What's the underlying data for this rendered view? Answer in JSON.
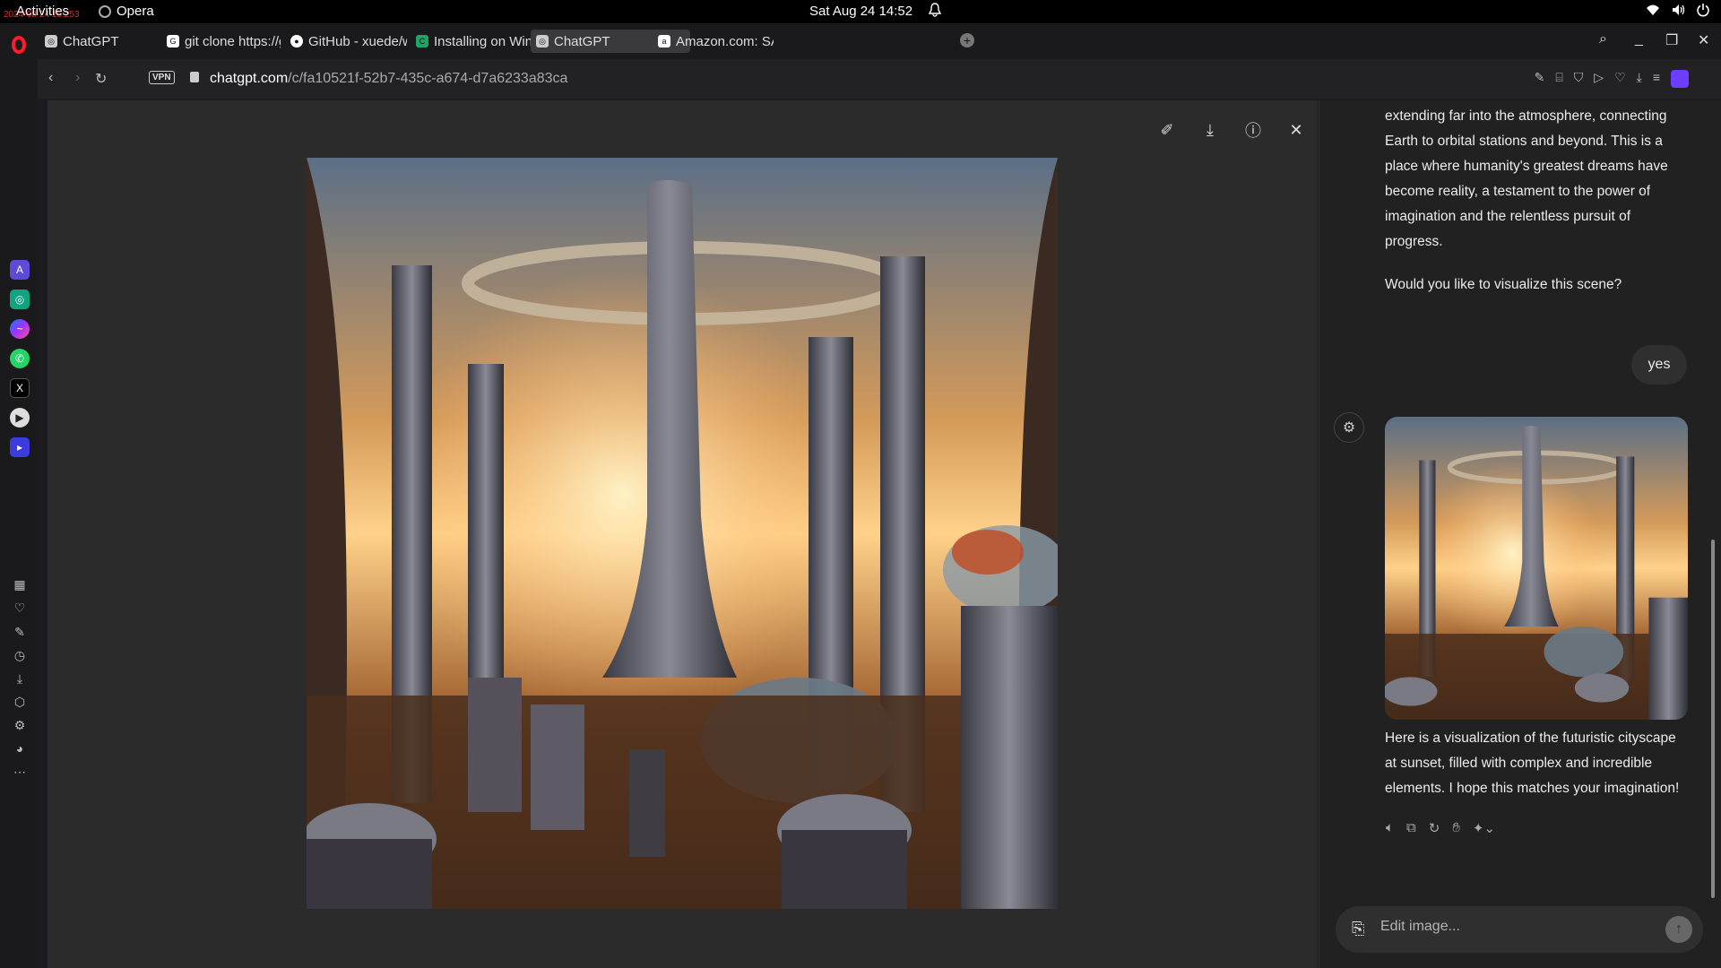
{
  "os": {
    "activities": "Activities",
    "app_name": "Opera",
    "clock": "Sat Aug 24  14:52",
    "rec_overlay": "2024-08-24 15:253"
  },
  "tabs": [
    {
      "label": "ChatGPT"
    },
    {
      "label": "git clone https://githu"
    },
    {
      "label": "GitHub - xuede/whisp"
    },
    {
      "label": "Installing on Window"
    },
    {
      "label": "ChatGPT"
    },
    {
      "label": "Amazon.com: SAMS"
    }
  ],
  "address": {
    "domain": "chatgpt.com",
    "path": "/c/fa10521f-52b7-435c-a674-d7a6233a83ca",
    "vpn": "VPN"
  },
  "chat": {
    "assistant_text_1": "extending far into the atmosphere, connecting Earth to orbital stations and beyond. This is a place where humanity's greatest dreams have become reality, a testament to the power of imagination and the relentless pursuit of progress.",
    "assistant_question": "Would you like to visualize this scene?",
    "user_reply": "yes",
    "assistant_text_2": "Here is a visualization of the futuristic cityscape at sunset, filled with complex and incredible elements. I hope this matches your imagination!",
    "composer_placeholder": "Edit image..."
  },
  "icons": {
    "viewer_tools": [
      "edit-icon",
      "download-icon",
      "info-icon",
      "close-icon"
    ],
    "message_actions": [
      "read-aloud-icon",
      "copy-icon",
      "regenerate-icon",
      "thumbs-down-icon",
      "sparkle-icon"
    ]
  }
}
